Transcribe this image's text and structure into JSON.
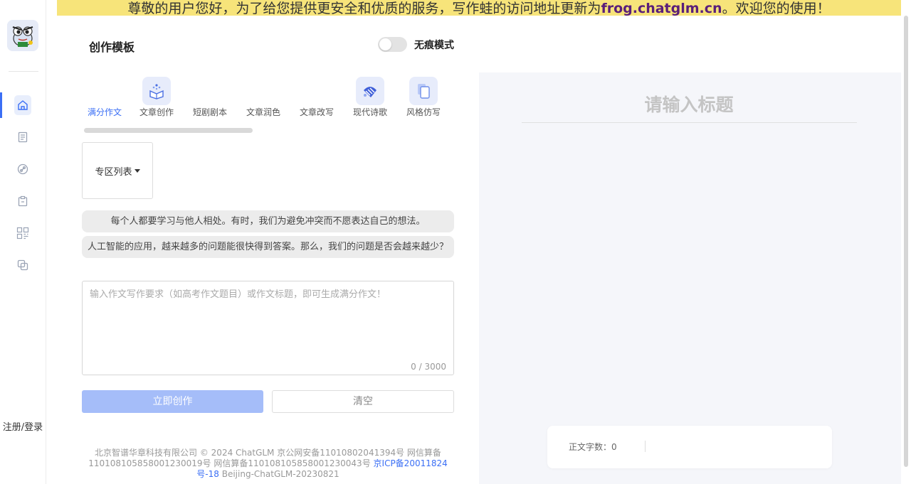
{
  "notice": {
    "prefix": "尊敬的用户您好，为了给您提供更安全和优质的服务，写作蛙的访问地址更新为",
    "domain": "frog.chatglm.cn",
    "suffix": "。欢迎您的使用！"
  },
  "sidebar": {
    "login_label": "注册/登录",
    "items": [
      {
        "icon": "home-icon"
      },
      {
        "icon": "document-list-icon"
      },
      {
        "icon": "link-icon"
      },
      {
        "icon": "clipboard-icon"
      },
      {
        "icon": "grid-apps-icon"
      },
      {
        "icon": "copy-icon"
      }
    ]
  },
  "header": {
    "title": "创作模板",
    "incognito_label": "无痕模式"
  },
  "tabs": [
    {
      "label": "满分作文",
      "active": true
    },
    {
      "label": "文章创作",
      "icon": "book-sparkle-icon"
    },
    {
      "label": "短剧剧本"
    },
    {
      "label": "文章润色"
    },
    {
      "label": "文章改写"
    },
    {
      "label": "现代诗歌",
      "icon": "brush-icon"
    },
    {
      "label": "风格仿写",
      "icon": "copy-pages-icon"
    }
  ],
  "zone": {
    "label": "专区列表"
  },
  "suggestions": [
    "每个人都要学习与他人相处。有时，我们为避免冲突而不愿表达自己的想法。",
    "人工智能的应用，越来越多的问题能很快得到答案。那么，我们的问题是否会越来越少？"
  ],
  "editor": {
    "placeholder": "输入作文写作要求（如高考作文题目）或作文标题，即可生成满分作文！",
    "value": "",
    "counter": "0 / 3000"
  },
  "actions": {
    "create_label": "立即创作",
    "clear_label": "清空"
  },
  "footer": {
    "text": "北京智谱华章科技有限公司 © 2024 ChatGLM 京公网安备11010802041394号 网信算备110108105858001230019号 网信算备110108105858001230043号",
    "icp_link": "京ICP备20011824号-18",
    "build": "Beijing-ChatGLM-20230821"
  },
  "document": {
    "title_placeholder": "请输入标题",
    "word_count_label": "正文字数：0"
  },
  "colors": {
    "accent": "#3b6ff5",
    "notice_bg": "#f7e47a",
    "notice_link": "#5a1f7a",
    "primary_disabled": "#a5bdf9"
  }
}
